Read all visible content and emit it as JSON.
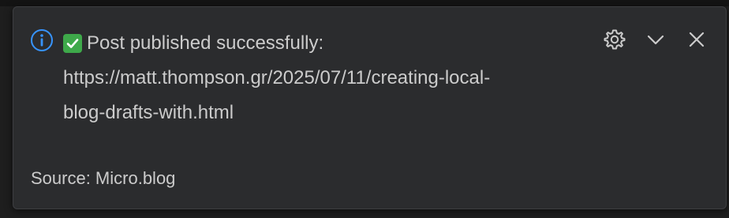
{
  "notification": {
    "title": "Post published successfully:",
    "url_line1": "https://matt.thompson.gr/2025/07/11/creating-local-",
    "url_line2": "blog-drafts-with.html",
    "source_text": "Source: Micro.blog",
    "icons": {
      "severity": "info-icon",
      "status": "check-mark-icon",
      "settings": "gear-icon",
      "collapse": "chevron-down-icon",
      "close": "close-icon"
    },
    "colors": {
      "info_accent": "#3794ff",
      "check_green": "#3ea94a",
      "text": "#cccccc",
      "background": "#2b2c2e"
    }
  }
}
